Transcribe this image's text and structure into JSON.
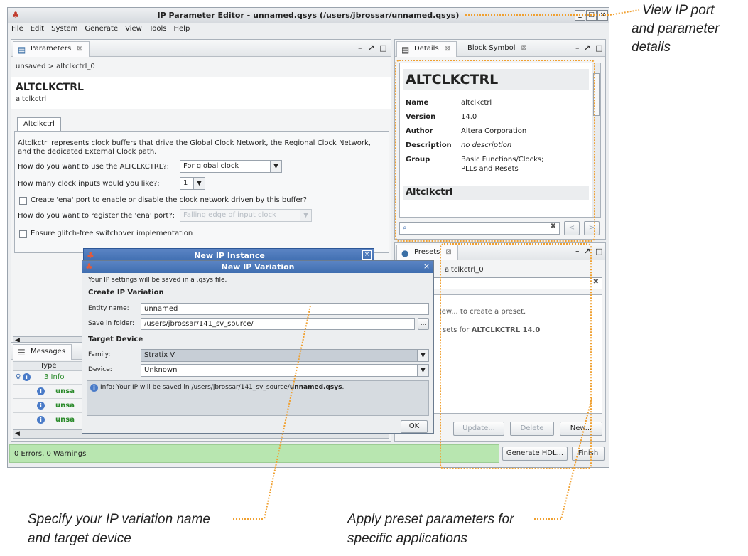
{
  "window": {
    "title": "IP Parameter Editor - unnamed.qsys (/users/jbrossar/unnamed.qsys)"
  },
  "menu": [
    "File",
    "Edit",
    "System",
    "Generate",
    "View",
    "Tools",
    "Help"
  ],
  "parameters": {
    "tab_label": "Parameters",
    "breadcrumb": "unsaved > altclkctrl_0",
    "component_title": "ALTCLKCTRL",
    "component_subtitle": "altclkctrl",
    "subtab": "Altclkctrl",
    "description_line1": "Altclkctrl represents clock buffers that drive the Global Clock Network, the Regional Clock Network,",
    "description_line2": "and the dedicated External Clock path.",
    "q_use_label": "How do you want to use the ALTCLKCTRL?:",
    "q_use_value": "For global clock",
    "q_inputs_label": "How many clock inputs would you like?:",
    "q_inputs_value": "1",
    "ena_port_label": "Create 'ena' port to enable or disable the clock network driven by this buffer?",
    "register_label": "How do you want to register the 'ena' port?:",
    "register_value": "Falling edge of input clock",
    "glitch_label": "Ensure glitch-free switchover implementation"
  },
  "details": {
    "tab_label": "Details",
    "tab2_label": "Block Symbol",
    "heading": "ALTCLKCTRL",
    "rows": [
      {
        "key": "Name",
        "value": "altclkctrl"
      },
      {
        "key": "Version",
        "value": "14.0"
      },
      {
        "key": "Author",
        "value": "Altera Corporation"
      },
      {
        "key": "Description",
        "value": "no description"
      },
      {
        "key": "Group",
        "value": "Basic Functions/Clocks;"
      }
    ],
    "group_line2": "PLLs and Resets",
    "subheading": "Altclkctrl"
  },
  "presets": {
    "tab_label": "Presets",
    "header_suffix": "altclkctrl_0",
    "hint_frag": "lew... to create a preset.",
    "list_frag": "sets for ",
    "list_bold": "ALTCLKCTRL 14.0",
    "update_label": "Update...",
    "delete_label": "Delete",
    "new_label": "New..."
  },
  "messages": {
    "tab_label": "Messages",
    "col_type": "Type",
    "row0_text": "3 Info",
    "row_frag": "unsa"
  },
  "status": {
    "text": "0 Errors, 0 Warnings",
    "generate_label": "Generate HDL...",
    "finish_label": "Finish"
  },
  "new_instance": {
    "title": "New IP Instance"
  },
  "variation": {
    "title": "New IP Variation",
    "intro": "Your IP settings will be saved in a .qsys file.",
    "section_create": "Create IP Variation",
    "entity_label": "Entity name:",
    "entity_value": "unnamed",
    "folder_label": "Save in folder:",
    "folder_value": "/users/jbrossar/141_sv_source/",
    "browse_label": "...",
    "section_target": "Target Device",
    "family_label": "Family:",
    "family_value": "Stratix V",
    "device_label": "Device:",
    "device_value": "Unknown",
    "info_prefix": "Info: Your IP will be saved in /users/jbrossar/141_sv_source/",
    "info_file": "unnamed.qsys",
    "info_suffix": ".",
    "ok_label": "OK"
  },
  "annotations": {
    "top_right_1": "View IP port",
    "top_right_2": "and parameter",
    "top_right_3": "details",
    "bottom_left_1": "Specify your IP variation name",
    "bottom_left_2": "and target device",
    "bottom_right_1": "Apply preset parameters for",
    "bottom_right_2": "specific applications"
  },
  "colors": {
    "accent": "#3f6eb0",
    "status_green": "#b8e6b0",
    "callout": "#f0a030"
  }
}
